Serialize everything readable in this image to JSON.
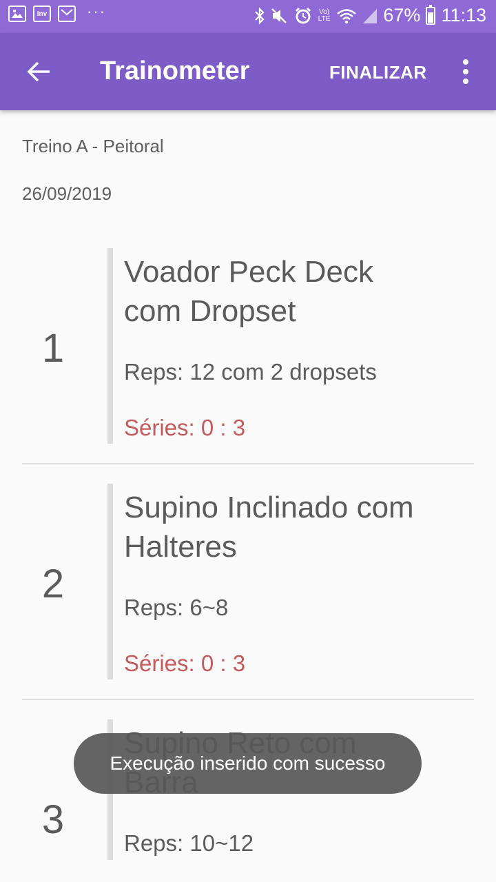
{
  "status_bar": {
    "icons": [
      "image-icon",
      "inv-icon",
      "mail-icon",
      "more-dots-icon",
      "bluetooth-icon",
      "mute-icon",
      "alarm-icon",
      "volte-icon",
      "wifi-icon",
      "signal-icon",
      "battery-icon"
    ],
    "inv_text": "Inv",
    "dots": "···",
    "volte_top": "Vo)",
    "volte_bottom": "LTE",
    "battery_percent": "67%",
    "battery_level": 0.67,
    "time": "11:13",
    "color": "#8f6ad6"
  },
  "app_bar": {
    "title": "Trainometer",
    "action": "FINALIZAR",
    "color": "#7e5cc7"
  },
  "workout": {
    "name": "Treino A - Peitoral",
    "date": "26/09/2019"
  },
  "exercises": [
    {
      "number": "1",
      "title_line1": "Voador Peck Deck",
      "title_line2": "com Dropset",
      "reps": "Reps: 12 com 2 dropsets",
      "series": "Séries: 0 : 3"
    },
    {
      "number": "2",
      "title_line1": "Supino Inclinado com",
      "title_line2": "Halteres",
      "reps": "Reps: 6~8",
      "series": "Séries: 0 : 3"
    },
    {
      "number": "3",
      "title_line1": "Supino Reto com",
      "title_line2": "Barra",
      "reps": "Reps: 10~12",
      "series": ""
    }
  ],
  "toast": {
    "message": "Execução inserido com sucesso"
  },
  "colors": {
    "series": "#c45a5a",
    "text": "#5b5b5b",
    "background": "#fafafa"
  }
}
